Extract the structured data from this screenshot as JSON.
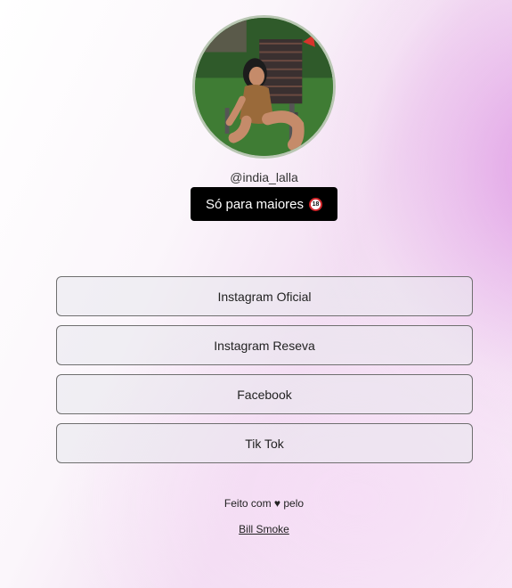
{
  "profile": {
    "username": "@india_lalla",
    "badge_label": "Só para maiores",
    "badge_icon": "adult-18-icon",
    "age_icon_text": "18"
  },
  "links": [
    {
      "label": "Instagram Oficial"
    },
    {
      "label": "Instagram Reseva"
    },
    {
      "label": "Facebook"
    },
    {
      "label": "Tik Tok"
    }
  ],
  "footer": {
    "made_with": "Feito com ♥ pelo",
    "author": "Bill Smoke"
  },
  "colors": {
    "accent_gradient": "#de96e4",
    "badge_bg": "#000000",
    "button_border": "#6f6f6f"
  }
}
